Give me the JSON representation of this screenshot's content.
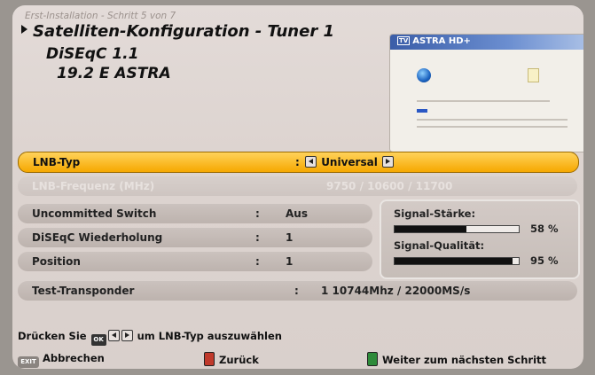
{
  "header": {
    "breadcrumb": "Erst-Installation - Schritt 5 von 7",
    "title": "Satelliten-Konfiguration - Tuner 1",
    "diseqc": "DiSEqC 1.1",
    "satellite": "19.2 E ASTRA"
  },
  "preview": {
    "channel_logo": "ASTRA HD+",
    "logo_badge": "TV"
  },
  "settings": [
    {
      "label": "LNB-Typ",
      "value": "Universal",
      "state": "selected"
    },
    {
      "label": "LNB-Frequenz (MHz)",
      "value": "9750 / 10600 / 11700",
      "state": "disabled"
    },
    {
      "label": "Uncommitted Switch",
      "value": "Aus",
      "state": "normal"
    },
    {
      "label": "DiSEqC Wiederholung",
      "value": "1",
      "state": "normal"
    },
    {
      "label": "Position",
      "value": "1",
      "state": "normal"
    }
  ],
  "transponder": {
    "label": "Test-Transponder",
    "value": "1  10744Mhz / 22000MS/s"
  },
  "signal": {
    "strength_label": "Signal-Stärke:",
    "strength_value": 58,
    "strength_text": "58 %",
    "quality_label": "Signal-Qualität:",
    "quality_value": 95,
    "quality_text": "95 %"
  },
  "hint": {
    "prefix": "Drücken Sie",
    "ok_key": "OK",
    "suffix": "um LNB-Typ auszuwählen"
  },
  "footer": {
    "exit_key": "EXIT",
    "cancel": "Abbrechen",
    "back": "Zurück",
    "next": "Weiter zum nächsten Schritt",
    "back_color": "#c0392b",
    "next_color": "#2e8b3a"
  },
  "colors": {
    "highlight": "#f6a800"
  }
}
